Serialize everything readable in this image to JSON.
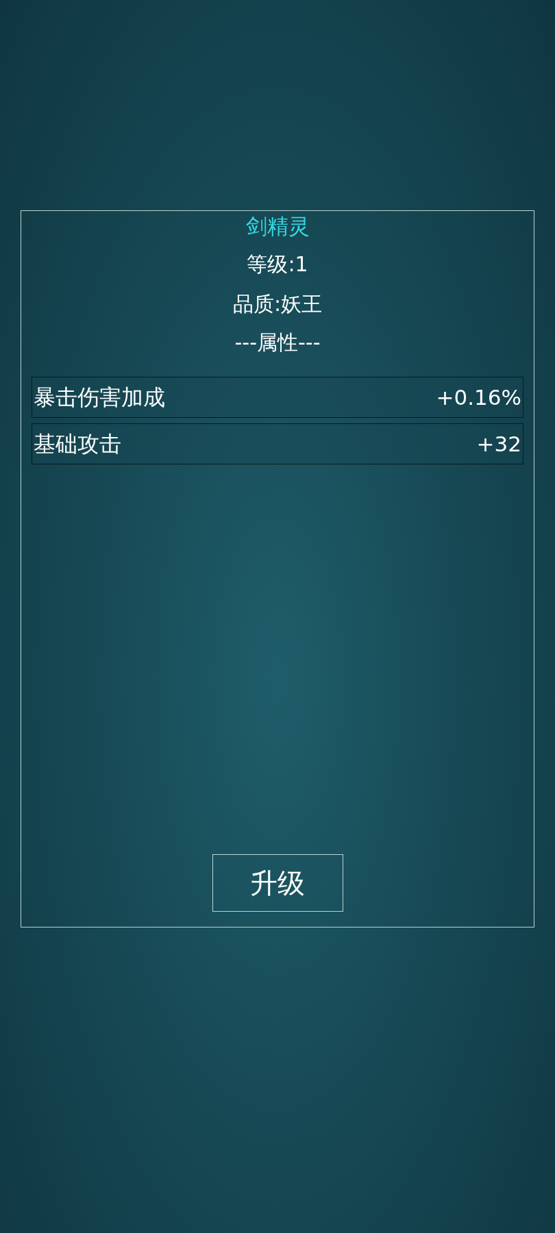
{
  "panel": {
    "name": "剑精灵",
    "level": "等级:1",
    "quality": "品质:妖王",
    "section_title": "---属性---",
    "attributes": [
      {
        "label": "暴击伤害加成",
        "value": "+0.16%"
      },
      {
        "label": "基础攻击",
        "value": "+32"
      }
    ],
    "button": "升级"
  }
}
